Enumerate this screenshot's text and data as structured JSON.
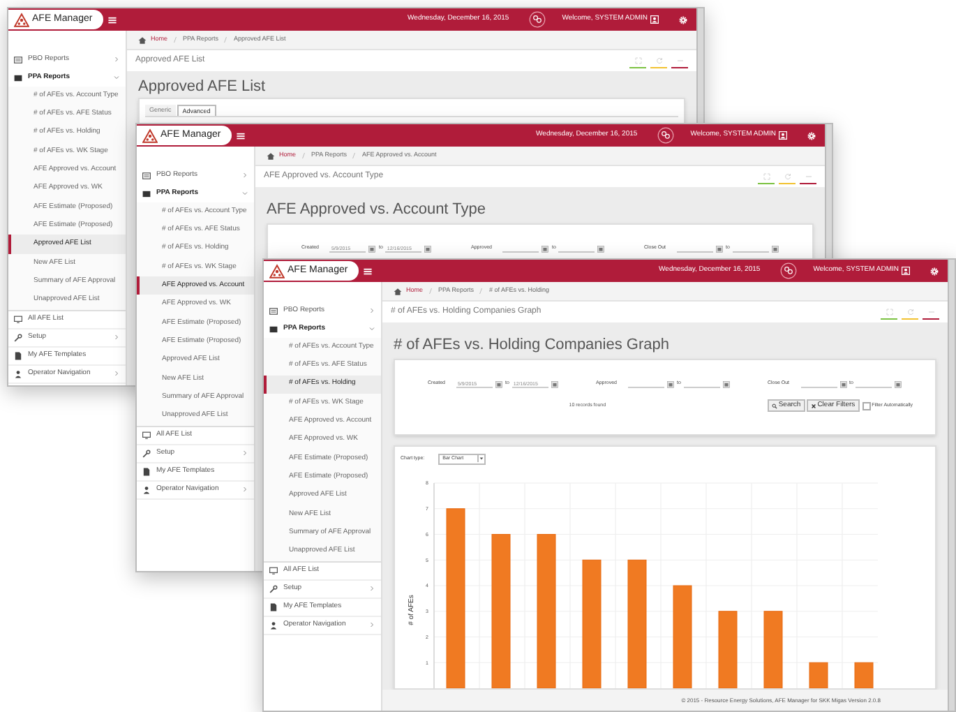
{
  "windows": [
    {
      "header": {
        "app_name": "AFE Manager",
        "date": "Wednesday, December 16, 2015",
        "welcome": "Welcome, SYSTEM ADMIN"
      },
      "sidebar": {
        "items": [
          {
            "label": "PBO Reports",
            "kind": "group",
            "expanded": false
          },
          {
            "label": "PPA Reports",
            "kind": "group",
            "expanded": true,
            "children": [
              {
                "label": "# of AFEs vs. Account Type",
                "selected": false
              },
              {
                "label": "# of AFEs vs. AFE Status",
                "selected": false
              },
              {
                "label": "# of AFEs vs. Holding",
                "selected": false
              },
              {
                "label": "# of AFEs vs. WK Stage",
                "selected": false
              },
              {
                "label": "AFE Approved vs. Account",
                "selected": false
              },
              {
                "label": "AFE Approved vs. WK",
                "selected": false
              },
              {
                "label": "AFE Estimate (Proposed)",
                "selected": false
              },
              {
                "label": "AFE Estimate (Proposed)",
                "selected": false
              },
              {
                "label": "Approved AFE List",
                "selected": true
              },
              {
                "label": "New AFE List",
                "selected": false
              },
              {
                "label": "Summary of AFE Approval",
                "selected": false
              },
              {
                "label": "Unapproved AFE List",
                "selected": false
              }
            ]
          },
          {
            "label": "All AFE List",
            "kind": "link"
          },
          {
            "label": "Setup",
            "kind": "group",
            "expanded": false
          },
          {
            "label": "My AFE Templates",
            "kind": "link"
          },
          {
            "label": "Operator Navigation",
            "kind": "group",
            "expanded": false
          }
        ]
      },
      "breadcrumb": [
        "Home",
        "PPA Reports",
        "Approved AFE List"
      ],
      "panel_title": "Approved AFE List",
      "heading": "Approved AFE List",
      "tabs": [
        {
          "label": "Generic",
          "selected": false
        },
        {
          "label": "Advanced",
          "selected": true
        }
      ]
    },
    {
      "header": {
        "app_name": "AFE Manager",
        "date": "Wednesday, December 16, 2015",
        "welcome": "Welcome, SYSTEM ADMIN"
      },
      "sidebar": {
        "items": [
          {
            "label": "PBO Reports",
            "kind": "group",
            "expanded": false
          },
          {
            "label": "PPA Reports",
            "kind": "group",
            "expanded": true,
            "children": [
              {
                "label": "# of AFEs vs. Account Type",
                "selected": false
              },
              {
                "label": "# of AFEs vs. AFE Status",
                "selected": false
              },
              {
                "label": "# of AFEs vs. Holding",
                "selected": false
              },
              {
                "label": "# of AFEs vs. WK Stage",
                "selected": false
              },
              {
                "label": "AFE Approved vs. Account",
                "selected": true
              },
              {
                "label": "AFE Approved vs. WK",
                "selected": false
              },
              {
                "label": "AFE Estimate (Proposed)",
                "selected": false
              },
              {
                "label": "AFE Estimate (Proposed)",
                "selected": false
              },
              {
                "label": "Approved AFE List",
                "selected": false
              },
              {
                "label": "New AFE List",
                "selected": false
              },
              {
                "label": "Summary of AFE Approval",
                "selected": false
              },
              {
                "label": "Unapproved AFE List",
                "selected": false
              }
            ]
          },
          {
            "label": "All AFE List",
            "kind": "link"
          },
          {
            "label": "Setup",
            "kind": "group",
            "expanded": false
          },
          {
            "label": "My AFE Templates",
            "kind": "link"
          },
          {
            "label": "Operator Navigation",
            "kind": "group",
            "expanded": false
          }
        ]
      },
      "breadcrumb": [
        "Home",
        "PPA Reports",
        "AFE Approved vs. Account"
      ],
      "panel_title": "AFE Approved vs. Account Type",
      "heading": "AFE Approved vs. Account Type",
      "filters": [
        {
          "label": "Created",
          "from": "5/9/2015",
          "to_word": "to",
          "until": "12/16/2015"
        },
        {
          "label": "Approved",
          "to_word": "to"
        },
        {
          "label": "Close Out",
          "to_word": "to"
        }
      ]
    },
    {
      "header": {
        "app_name": "AFE Manager",
        "date": "Wednesday, December 16, 2015",
        "welcome": "Welcome, SYSTEM ADMIN"
      },
      "sidebar": {
        "items": [
          {
            "label": "PBO Reports",
            "kind": "group",
            "expanded": false
          },
          {
            "label": "PPA Reports",
            "kind": "group",
            "expanded": true,
            "children": [
              {
                "label": "# of AFEs vs. Account Type",
                "selected": false
              },
              {
                "label": "# of AFEs vs. AFE Status",
                "selected": false
              },
              {
                "label": "# of AFEs vs. Holding",
                "selected": true
              },
              {
                "label": "# of AFEs vs. WK Stage",
                "selected": false
              },
              {
                "label": "AFE Approved vs. Account",
                "selected": false
              },
              {
                "label": "AFE Approved vs. WK",
                "selected": false
              },
              {
                "label": "AFE Estimate (Proposed)",
                "selected": false
              },
              {
                "label": "AFE Estimate (Proposed)",
                "selected": false
              },
              {
                "label": "Approved AFE List",
                "selected": false
              },
              {
                "label": "New AFE List",
                "selected": false
              },
              {
                "label": "Summary of AFE Approval",
                "selected": false
              },
              {
                "label": "Unapproved AFE List",
                "selected": false
              }
            ]
          },
          {
            "label": "All AFE List",
            "kind": "link"
          },
          {
            "label": "Setup",
            "kind": "group",
            "expanded": false
          },
          {
            "label": "My AFE Templates",
            "kind": "link"
          },
          {
            "label": "Operator Navigation",
            "kind": "group",
            "expanded": false
          }
        ]
      },
      "breadcrumb": [
        "Home",
        "PPA Reports",
        "# of AFEs vs. Holding"
      ],
      "panel_title": "# of AFEs vs. Holding Companies Graph",
      "heading": "# of AFEs vs. Holding Companies Graph",
      "filters": [
        {
          "label": "Created",
          "from": "5/9/2015",
          "to_word": "to",
          "until": "12/16/2015"
        },
        {
          "label": "Approved",
          "to_word": "to"
        },
        {
          "label": "Close Out",
          "to_word": "to"
        }
      ],
      "records": "10 records found",
      "buttons": [
        "Search",
        "Clear Filters"
      ],
      "auto_filter": {
        "label": "Filter Automatically",
        "checked": false
      },
      "chart_type": {
        "label": "Chart type:",
        "value": "Bar Chart"
      },
      "chart_data": {
        "type": "bar",
        "ylabel": "# of AFEs",
        "ylim": [
          0,
          8
        ],
        "yticks": [
          1,
          2,
          3,
          4,
          5,
          6,
          7,
          8
        ],
        "grid": true,
        "values": [
          7,
          6,
          6,
          5,
          5,
          4,
          3,
          3,
          1,
          1
        ]
      },
      "footer": "© 2015 - Resource Energy Solutions, AFE Manager for SKK Migas Version 2.0.8"
    }
  ]
}
